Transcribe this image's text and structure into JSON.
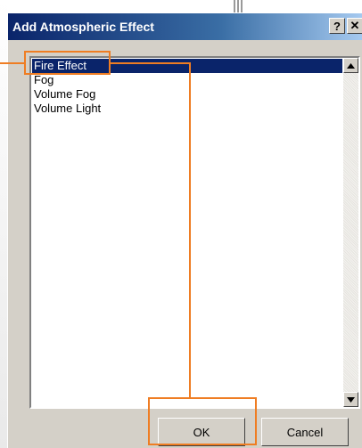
{
  "dialog": {
    "title": "Add Atmospheric Effect",
    "help_button_label": "?",
    "close_button_label": "✕"
  },
  "effects_list": {
    "items": [
      {
        "label": "Fire Effect",
        "selected": true
      },
      {
        "label": "Fog",
        "selected": false
      },
      {
        "label": "Volume Fog",
        "selected": false
      },
      {
        "label": "Volume Light",
        "selected": false
      }
    ]
  },
  "buttons": {
    "ok_label": "OK",
    "cancel_label": "Cancel"
  },
  "colors": {
    "selection_bg": "#0a246a",
    "annotation": "#ef7d23",
    "dialog_face": "#d4d0c8"
  }
}
